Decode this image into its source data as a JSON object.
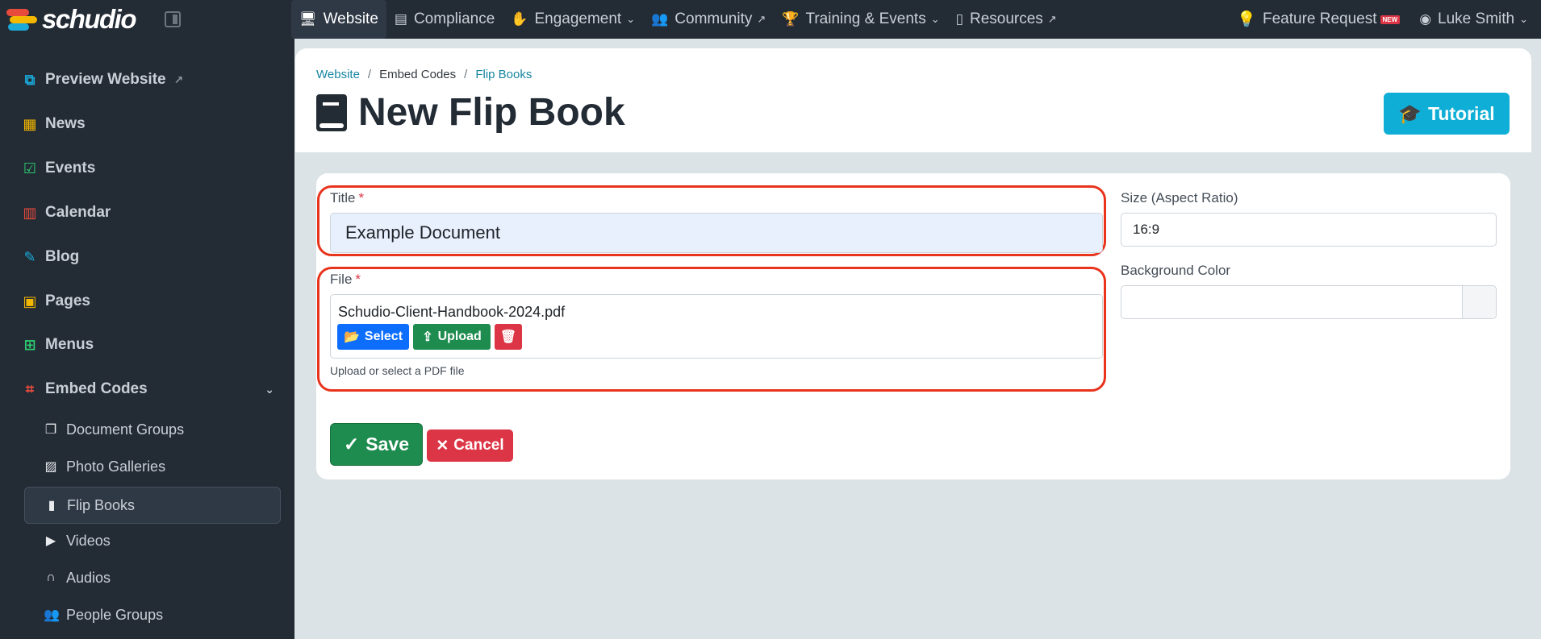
{
  "brand": {
    "name": "schudio",
    "logo_colors": [
      "#e84b3c",
      "#f5b800",
      "#1aa9d8",
      "#2ecc71"
    ]
  },
  "topnav": {
    "items": [
      {
        "label": "Website",
        "icon": "monitor-icon",
        "active": true
      },
      {
        "label": "Compliance",
        "icon": "ledger-icon",
        "dropdown": false
      },
      {
        "label": "Engagement",
        "icon": "handshake-icon",
        "dropdown": true
      },
      {
        "label": "Community",
        "icon": "users-icon",
        "external": true
      },
      {
        "label": "Training & Events",
        "icon": "trophy-icon",
        "dropdown": true
      },
      {
        "label": "Resources",
        "icon": "file-icon",
        "external": true
      }
    ],
    "feature_request": "Feature Request",
    "new_badge": "NEW",
    "user_name": "Luke Smith"
  },
  "sidebar": {
    "items": [
      {
        "label": "Preview Website",
        "icon": "preview-icon",
        "color": "#1aa9d8"
      },
      {
        "label": "News",
        "icon": "newspaper-icon",
        "color": "#f5b800"
      },
      {
        "label": "Events",
        "icon": "calendar-check-icon",
        "color": "#2ecc71"
      },
      {
        "label": "Calendar",
        "icon": "calendar-icon",
        "color": "#e84b3c"
      },
      {
        "label": "Blog",
        "icon": "blog-icon",
        "color": "#1aa9d8"
      },
      {
        "label": "Pages",
        "icon": "pages-icon",
        "color": "#f5b800"
      },
      {
        "label": "Menus",
        "icon": "menus-icon",
        "color": "#2ecc71"
      },
      {
        "label": "Embed Codes",
        "icon": "embed-icon",
        "color": "#e84b3c"
      }
    ],
    "sub_items": [
      {
        "label": "Document Groups",
        "icon": "copy-icon"
      },
      {
        "label": "Photo Galleries",
        "icon": "image-icon"
      },
      {
        "label": "Flip Books",
        "icon": "book-icon",
        "active": true
      },
      {
        "label": "Videos",
        "icon": "youtube-icon"
      },
      {
        "label": "Audios",
        "icon": "headphones-icon"
      },
      {
        "label": "People Groups",
        "icon": "people-icon"
      }
    ]
  },
  "breadcrumb": [
    "Website",
    "Embed Codes",
    "Flip Books"
  ],
  "page_title": "New Flip Book",
  "tutorial_label": "Tutorial",
  "form": {
    "title_label": "Title",
    "title_value": "Example Document",
    "file_label": "File",
    "file_name": "Schudio-Client-Handbook-2024.pdf",
    "select_label": "Select",
    "upload_label": "Upload",
    "file_help": "Upload or select a PDF file",
    "size_label": "Size (Aspect Ratio)",
    "size_value": "16:9",
    "bg_color_label": "Background Color",
    "bg_color_value": "",
    "save_label": "Save",
    "cancel_label": "Cancel"
  },
  "colors": {
    "sidebar_bg": "#232b35",
    "accent_teal": "#0eaed6",
    "save_green": "#1e8c4f",
    "cancel_red": "#dc3545",
    "select_blue": "#0d6efd",
    "highlight_red": "#e8341c"
  }
}
